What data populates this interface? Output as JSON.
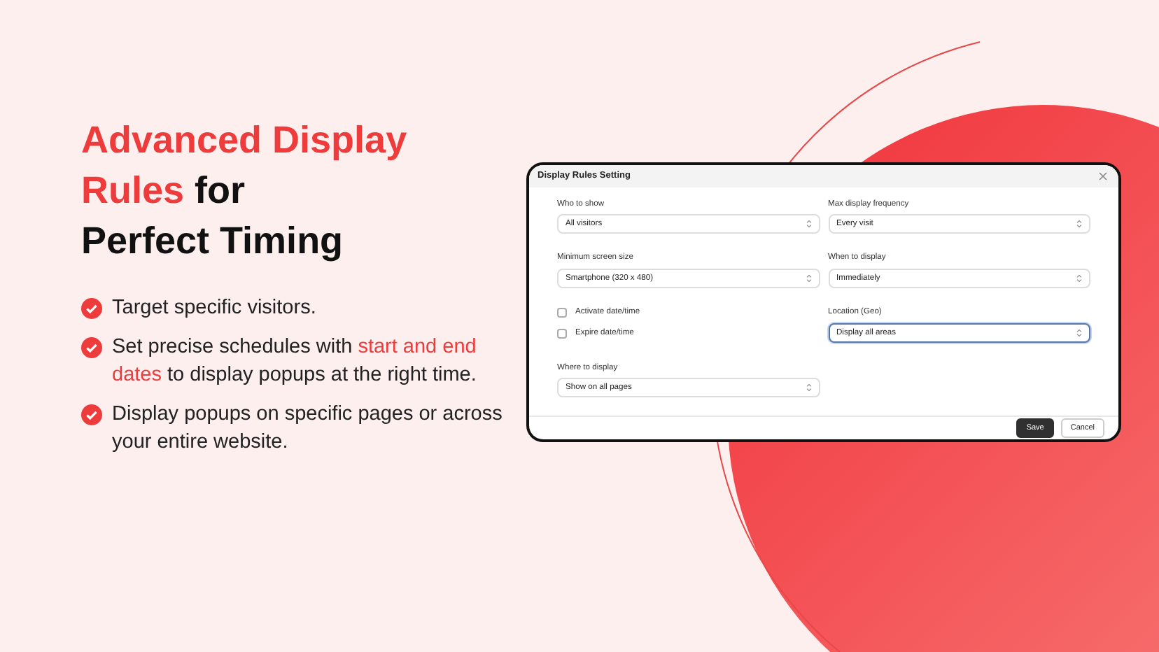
{
  "headline": [
    [
      {
        "text": "Advanced Display",
        "accent": true
      }
    ],
    [
      {
        "text": "Rules",
        "accent": true
      },
      {
        "text": " for",
        "accent": false
      }
    ],
    [
      {
        "text": "Perfect Timing",
        "accent": false
      }
    ]
  ],
  "bullets": [
    [
      {
        "text": "Target specific visitors.",
        "accent": false
      }
    ],
    [
      {
        "text": "Set precise schedules with ",
        "accent": false
      },
      {
        "text": "start and end dates",
        "accent": true
      },
      {
        "text": " to display popups at the right time.",
        "accent": false
      }
    ],
    [
      {
        "text": "Display popups on specific pages or across your entire website.",
        "accent": false
      }
    ]
  ],
  "dialog": {
    "title": "Display Rules Setting",
    "columns": [
      [
        {
          "kind": "select",
          "label": "Who to show",
          "value": "All visitors",
          "focused": false
        },
        {
          "kind": "select",
          "label": "Minimum screen size",
          "value": "Smartphone (320 x 480)",
          "focused": false
        },
        {
          "kind": "checkbox",
          "label": "Activate date/time",
          "checked": false
        },
        {
          "kind": "checkbox",
          "label": "Expire date/time",
          "checked": false
        },
        {
          "kind": "select",
          "label": "Where to display",
          "value": "Show on all pages",
          "focused": false
        }
      ],
      [
        {
          "kind": "select",
          "label": "Max display frequency",
          "value": "Every visit",
          "focused": false
        },
        {
          "kind": "select",
          "label": "When to display",
          "value": "Immediately",
          "focused": false
        },
        {
          "kind": "select",
          "label": "Location (Geo)",
          "value": "Display all areas",
          "focused": true
        }
      ]
    ],
    "buttons": [
      {
        "label": "Save",
        "primary": true
      },
      {
        "label": "Cancel",
        "primary": false
      }
    ]
  }
}
